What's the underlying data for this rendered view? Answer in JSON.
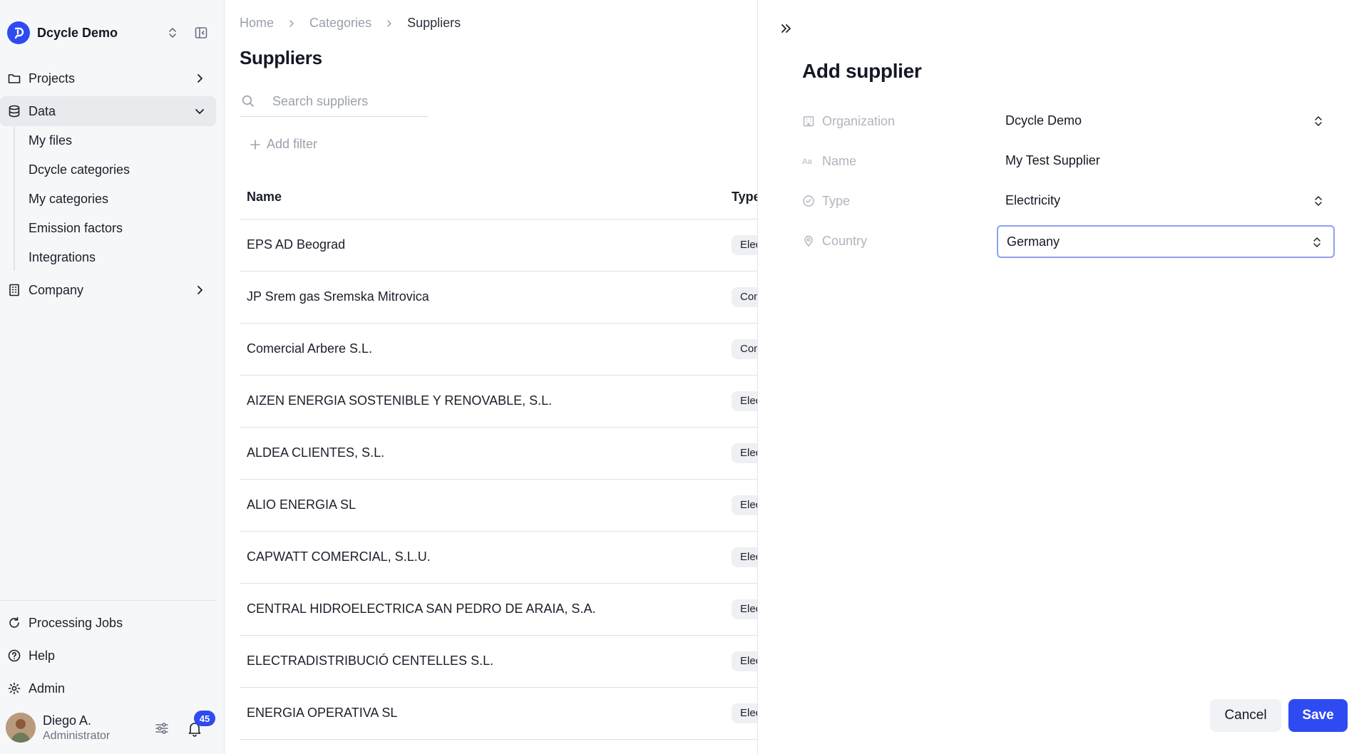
{
  "workspace": {
    "name": "Dcycle Demo"
  },
  "sidebar": {
    "nav": [
      {
        "label": "Projects"
      },
      {
        "label": "Data"
      },
      {
        "label": "Company"
      }
    ],
    "data_children": [
      {
        "label": "My files"
      },
      {
        "label": "Dcycle categories"
      },
      {
        "label": "My categories"
      },
      {
        "label": "Emission factors"
      },
      {
        "label": "Integrations"
      }
    ],
    "bottom": [
      {
        "label": "Processing Jobs"
      },
      {
        "label": "Help"
      },
      {
        "label": "Admin"
      }
    ],
    "user": {
      "name": "Diego A.",
      "role": "Administrator",
      "notifications": "45"
    }
  },
  "breadcrumb": [
    "Home",
    "Categories",
    "Suppliers"
  ],
  "page": {
    "title": "Suppliers",
    "search_placeholder": "Search suppliers",
    "add_filter": "Add filter"
  },
  "table": {
    "columns": [
      "Name",
      "Type"
    ],
    "rows": [
      {
        "name": "EPS AD Beograd",
        "type": "Electricity"
      },
      {
        "name": "JP Srem gas Sremska Mitrovica",
        "type": "Combustion"
      },
      {
        "name": "Comercial Arbere S.L.",
        "type": "Combustion"
      },
      {
        "name": "AIZEN ENERGIA SOSTENIBLE Y RENOVABLE, S.L.",
        "type": "Electricity"
      },
      {
        "name": "ALDEA CLIENTES, S.L.",
        "type": "Electricity"
      },
      {
        "name": "ALIO ENERGIA SL",
        "type": "Electricity"
      },
      {
        "name": "CAPWATT COMERCIAL, S.L.U.",
        "type": "Electricity"
      },
      {
        "name": "CENTRAL HIDROELECTRICA SAN PEDRO DE ARAIA, S.A.",
        "type": "Electricity"
      },
      {
        "name": "ELECTRADISTRIBUCIÓ CENTELLES S.L.",
        "type": "Electricity"
      },
      {
        "name": "ENERGIA OPERATIVA SL",
        "type": "Electricity"
      }
    ]
  },
  "drawer": {
    "title": "Add supplier",
    "fields": [
      {
        "label": "Organization",
        "value": "Dcycle Demo"
      },
      {
        "label": "Name",
        "value": "My Test Supplier"
      },
      {
        "label": "Type",
        "value": "Electricity"
      },
      {
        "label": "Country",
        "value": "Germany"
      }
    ],
    "cancel_label": "Cancel",
    "save_label": "Save"
  },
  "colors": {
    "accent": "#2e4bf2",
    "sidebar_bg": "#f6f7f9",
    "pill_bg": "#eef0f3"
  }
}
